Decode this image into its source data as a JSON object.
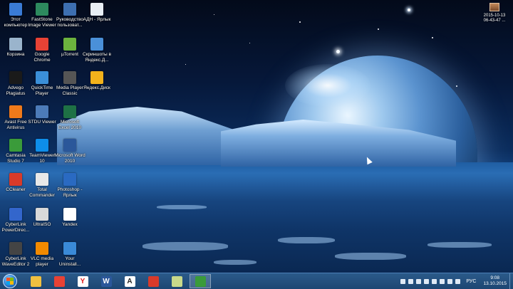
{
  "desktop_icons": [
    {
      "label": "Этот компьютер",
      "icon": "computer-icon",
      "color": "#3a7bd5"
    },
    {
      "label": "FastStone Image Viewer",
      "icon": "faststone-icon",
      "color": "#2d8a5e"
    },
    {
      "label": "Руководство пользоват...",
      "icon": "manual-icon",
      "color": "#3d6fb0"
    },
    {
      "label": "АДН - Ярлык",
      "icon": "document-shortcut-icon",
      "color": "#e8eef5"
    },
    {
      "label": "Корзина",
      "icon": "recycle-bin-icon",
      "color": "#9ab4cc"
    },
    {
      "label": "Google Chrome",
      "icon": "chrome-icon",
      "color": "#e84235"
    },
    {
      "label": "µTorrent",
      "icon": "utorrent-icon",
      "color": "#6cb33e"
    },
    {
      "label": "Скриншоты в Яндекс.Д...",
      "icon": "yandex-disk-icon",
      "color": "#4a90d9"
    },
    {
      "label": "Advego Plagiatus",
      "icon": "advego-icon",
      "color": "#1a1a1a"
    },
    {
      "label": "QuickTime Player",
      "icon": "quicktime-icon",
      "color": "#3b8fd8"
    },
    {
      "label": "Media Player Classic",
      "icon": "mpc-icon",
      "color": "#555555"
    },
    {
      "label": "Яндекс.Диск",
      "icon": "yandex-disk-folder-icon",
      "color": "#f2b21b"
    },
    {
      "label": "Avast Free Antivirus",
      "icon": "avast-icon",
      "color": "#f07a1a"
    },
    {
      "label": "STDU Viewer",
      "icon": "stdu-icon",
      "color": "#4c7bb8"
    },
    {
      "label": "Microsoft Excel 2010",
      "icon": "excel-icon",
      "color": "#1e7145"
    },
    {
      "label": "Camtasia Studio 7",
      "icon": "camtasia-icon",
      "color": "#3a9b3a"
    },
    {
      "label": "TeamViewer 10",
      "icon": "teamviewer-icon",
      "color": "#0e8ee9"
    },
    {
      "label": "Microsoft Word 2010",
      "icon": "word-icon",
      "color": "#2b579a"
    },
    {
      "label": "CCleaner",
      "icon": "ccleaner-icon",
      "color": "#d83a2a"
    },
    {
      "label": "Total Commander",
      "icon": "total-commander-icon",
      "color": "#e8e8e8"
    },
    {
      "label": "Photoshop - Ярлык",
      "icon": "photoshop-icon",
      "color": "#2a6ac2"
    },
    {
      "label": "CyberLink PowerDirec...",
      "icon": "powerdirector-icon",
      "color": "#3366cc"
    },
    {
      "label": "UltraISO",
      "icon": "ultraiso-icon",
      "color": "#d9d9d9"
    },
    {
      "label": "Yandex",
      "icon": "yandex-icon",
      "color": "#ffffff"
    },
    {
      "label": "CyberLink WaveEditor 2",
      "icon": "waveeditor-icon",
      "color": "#444444"
    },
    {
      "label": "VLC media player",
      "icon": "vlc-icon",
      "color": "#f28a00"
    },
    {
      "label": "Your Uninstall...",
      "icon": "uninstaller-icon",
      "color": "#3a8ad8"
    }
  ],
  "gadget": {
    "line1": "2015-10-13",
    "line2": "06-43-47 ..."
  },
  "taskbar": {
    "pinned": [
      {
        "name": "file-explorer-icon",
        "color": "#f0c040",
        "glyph": ""
      },
      {
        "name": "chrome-icon",
        "color": "#e84235",
        "glyph": ""
      },
      {
        "name": "yandex-browser-icon",
        "color": "#ffffff",
        "glyph": "Y"
      },
      {
        "name": "word-icon",
        "color": "#2b579a",
        "glyph": "W"
      },
      {
        "name": "advego-icon",
        "color": "#ffffff",
        "glyph": "A"
      },
      {
        "name": "pdf-icon",
        "color": "#d83a2a",
        "glyph": ""
      },
      {
        "name": "notes-icon",
        "color": "#c9d98a",
        "glyph": ""
      },
      {
        "name": "camtasia-icon",
        "color": "#3a9b3a",
        "glyph": ""
      }
    ],
    "language": "РУС",
    "time": "9:08",
    "date": "13.10.2015"
  }
}
